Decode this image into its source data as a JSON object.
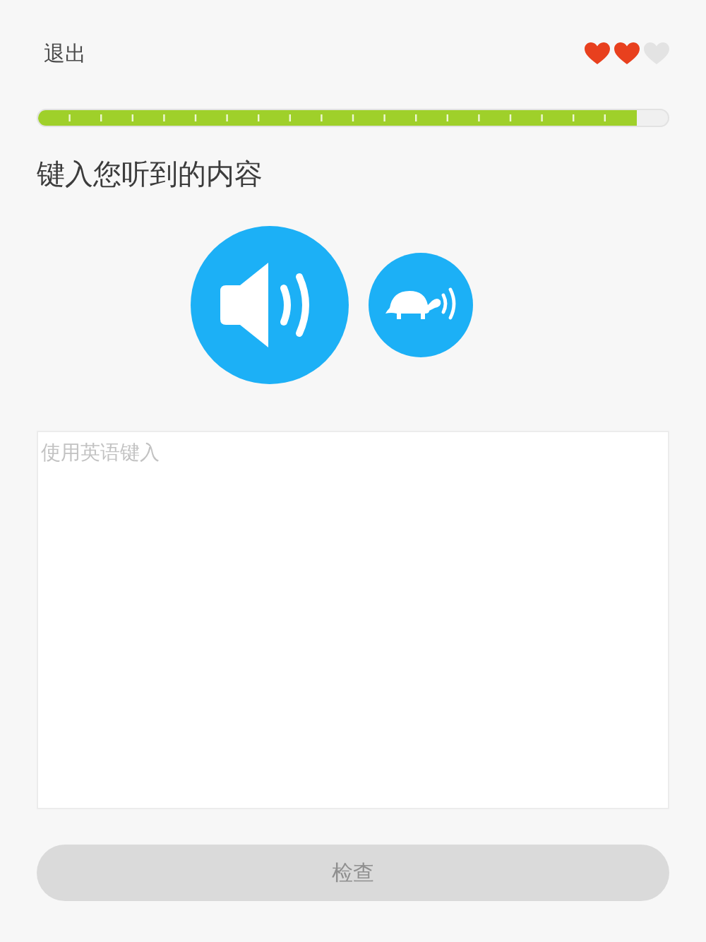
{
  "header": {
    "quit": "退出",
    "hearts": [
      {
        "filled": true
      },
      {
        "filled": true
      },
      {
        "filled": false
      }
    ]
  },
  "progress": {
    "level": 0.95
  },
  "prompt": "键入您听到的内容",
  "answer": {
    "placeholder": "使用英语键入"
  },
  "check_button": {
    "label": "检查",
    "disabled": true
  }
}
